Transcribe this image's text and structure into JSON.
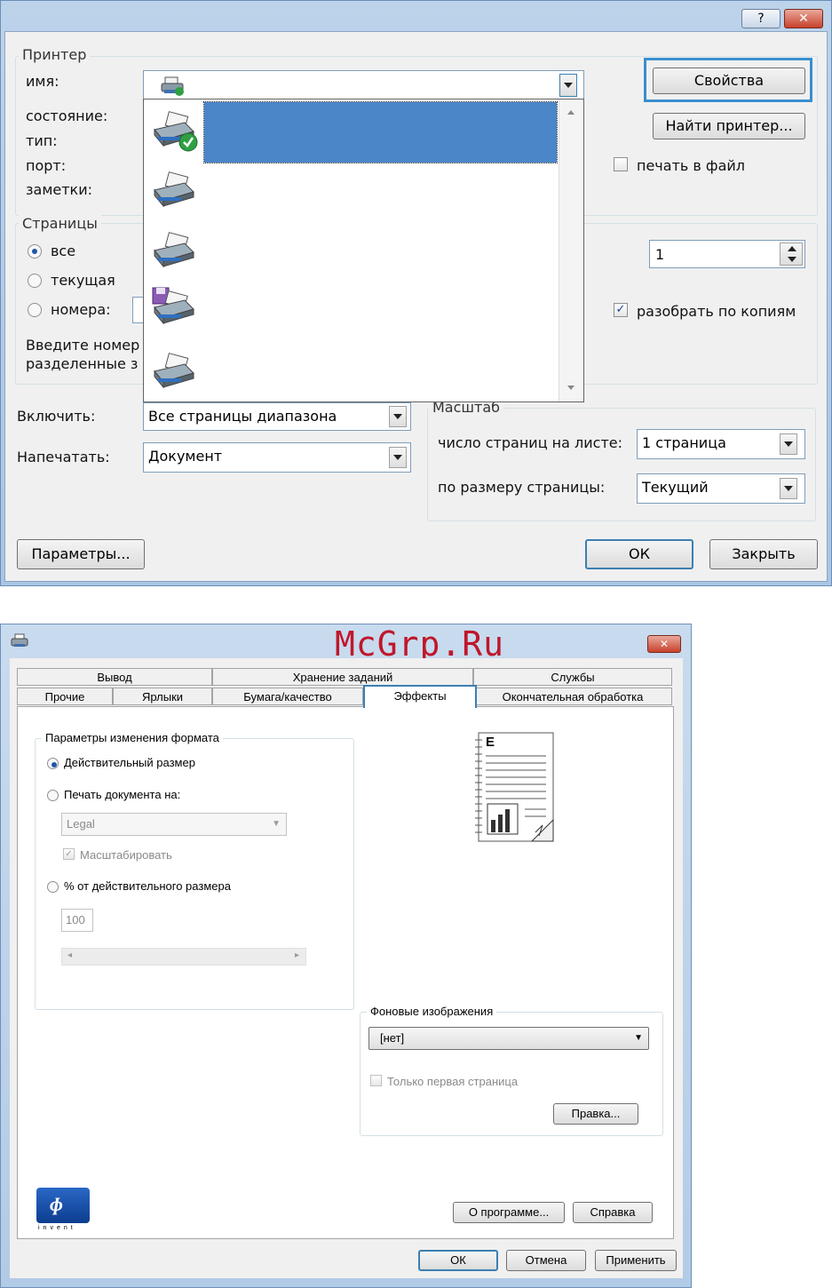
{
  "print_dialog": {
    "help_btn": "?",
    "close_btn": "✕",
    "printer_group": {
      "title": "Принтер",
      "name_label": "имя:",
      "status_label": "состояние:",
      "type_label": "тип:",
      "port_label": "порт:",
      "comment_label": "заметки:",
      "properties_btn": "Свойства",
      "find_printer_btn": "Найти принтер...",
      "print_to_file_label": "печать в файл",
      "print_to_file_checked": false
    },
    "pages_group": {
      "title": "Страницы",
      "all_label": "все",
      "current_label": "текущая",
      "pages_label": "номера:",
      "hint_line1": "Введите номер",
      "hint_line2": "разделенные з",
      "selected": "all"
    },
    "copies": {
      "value": "1",
      "collate_label": "разобрать по копиям",
      "collate_checked": true
    },
    "include_label": "Включить:",
    "include_value": "Все страницы диапазона",
    "print_what_label": "Напечатать:",
    "print_what_value": "Документ",
    "scale_group": {
      "title": "Масштаб",
      "pages_per_sheet_label": "число страниц на листе:",
      "pages_per_sheet_value": "1 страница",
      "fit_to_label": "по размеру страницы:",
      "fit_to_value": "Текущий"
    },
    "options_btn": "Параметры...",
    "ok_btn": "ОК",
    "close_dialog_btn": "Закрыть",
    "printer_list_count": 5,
    "selected_color": "#4a86c8"
  },
  "hp_dialog": {
    "watermark": "McGrp.Ru",
    "close_btn": "✕",
    "tabs_row1": [
      "Вывод",
      "Хранение заданий",
      "Службы"
    ],
    "tabs_row2": [
      "Прочие",
      "Ярлыки",
      "Бумага/качество",
      "Эффекты",
      "Окончательная обработка"
    ],
    "active_tab": "Эффекты",
    "resize_group": {
      "title": "Параметры изменения формата",
      "actual_size_label": "Действительный размер",
      "print_on_label": "Печать документа на:",
      "paper_value": "Legal",
      "scale_to_fit_label": "Масштабировать",
      "percent_label": "% от действительного размера",
      "percent_value": "100",
      "selected": "actual_size"
    },
    "preview_letter": "E",
    "watermarks_group": {
      "title": "Фоновые изображения",
      "value": "[нет]",
      "first_page_only_label": "Только первая страница",
      "edit_btn": "Правка..."
    },
    "logo_text": "invent",
    "about_btn": "О программе...",
    "help_btn": "Справка",
    "ok_btn": "ОК",
    "cancel_btn": "Отмена",
    "apply_btn": "Применить",
    "accent_color": "#3c7fb1"
  }
}
